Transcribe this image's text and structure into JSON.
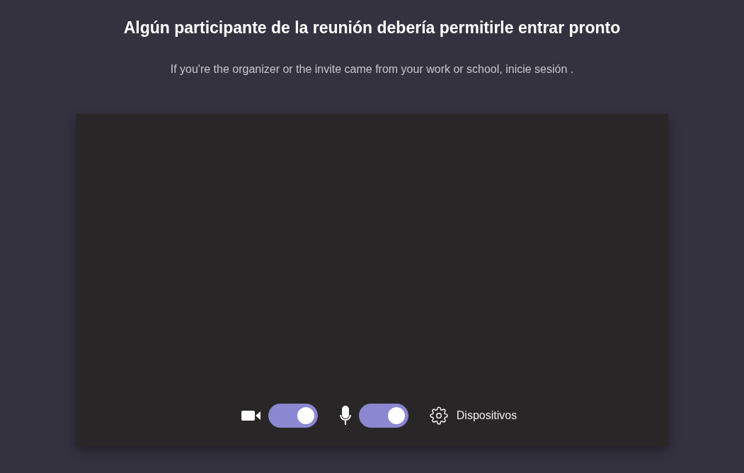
{
  "title": "Algún participante de la reunión debería permitirle entrar pronto",
  "subtitle": "If you're the organizer or the invite came from your work or school, inicie sesión .",
  "controls": [
    {
      "kind": "camera",
      "on": true
    },
    {
      "kind": "microphone",
      "on": true
    }
  ],
  "devices_button": {
    "label": "Dispositivos"
  }
}
